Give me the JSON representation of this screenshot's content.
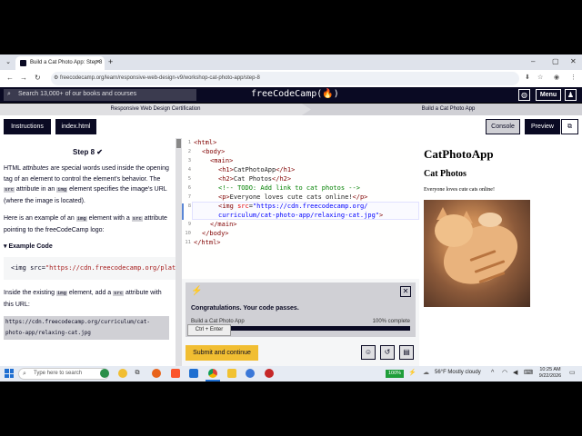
{
  "browser": {
    "tab_title": "Build a Cat Photo App: Step 8",
    "url": "freecodecamp.org/learn/responsive-web-design-v9/workshop-cat-photo-app/step-8"
  },
  "fcc_nav": {
    "search_placeholder": "Search 13,000+ of our books and courses",
    "logo": "freeCodeCamp(🔥)",
    "menu_label": "Menu"
  },
  "breadcrumbs": [
    "Responsive Web Design Certification",
    "Build a Cat Photo App"
  ],
  "toolbar": {
    "instructions_label": "Instructions",
    "file_tab_label": "index.html",
    "console_label": "Console",
    "preview_label": "Preview"
  },
  "lesson": {
    "step_title": "Step 8",
    "check": "✔",
    "p1_a": "HTML ",
    "p1_em": "attributes",
    "p1_b": " are special words used inside the opening tag of an element to control the element's behavior. The ",
    "p1_code1": "src",
    "p1_c": " attribute in an ",
    "p1_code2": "img",
    "p1_d": " element specifies the image's URL (where the image is located).",
    "p2_a": "Here is an example of an ",
    "p2_code1": "img",
    "p2_b": " element with a ",
    "p2_code2": "src",
    "p2_c": " attribute pointing to the freeCodeCamp logo:",
    "example_heading": "Example Code",
    "example_tag": "<img src=",
    "example_value": "\"https://cdn.freecodecamp.org/plat",
    "p3_a": "Inside the existing ",
    "p3_code1": "img",
    "p3_b": " element, add a ",
    "p3_code2": "src",
    "p3_c": " attribute with this URL:",
    "url_code": "https://cdn.freecodecamp.org/curriculum/cat-photo-app/relaxing-cat.jpg"
  },
  "editor": {
    "line_numbers": [
      "1",
      "2",
      "3",
      "4",
      "5",
      "6",
      "7",
      "8",
      "9",
      "10",
      "11"
    ],
    "l1": "<html>",
    "l2": "<body>",
    "l3": "<main>",
    "l4_open": "<h1>",
    "l4_text": "CatPhotoApp",
    "l4_close": "</h1>",
    "l5_open": "<h2>",
    "l5_text": "Cat Photos",
    "l5_close": "</h2>",
    "l6": "<!-- TODO: Add link to cat photos -->",
    "l7_open": "<p>",
    "l7_text": "Everyone loves cute cats online!",
    "l7_close": "</p>",
    "l8_tag": "<img ",
    "l8_attr": "src",
    "l8_eq": "=",
    "l8_val1": "\"https://cdn.freecodecamp.org/",
    "l8_val2": "curriculum/cat-photo-app/relaxing-cat.jpg\"",
    "l8_end": ">",
    "l9": "</main>",
    "l10": "</body>",
    "l11": "</html>"
  },
  "result": {
    "message": "Congratulations. Your code passes.",
    "project": "Build a Cat Photo App",
    "progress_label": "100% complete",
    "progress": 1.0,
    "tooltip": "Ctrl + Enter",
    "submit_label": "Submit and continue"
  },
  "preview": {
    "h1": "CatPhotoApp",
    "h2": "Cat Photos",
    "p": "Everyone loves cute cats online!"
  },
  "taskbar": {
    "search_placeholder": "Type here to search",
    "battery": "100%",
    "weather": "56°F  Mostly cloudy",
    "time": "10:25 AM",
    "date": "9/22/2026"
  }
}
